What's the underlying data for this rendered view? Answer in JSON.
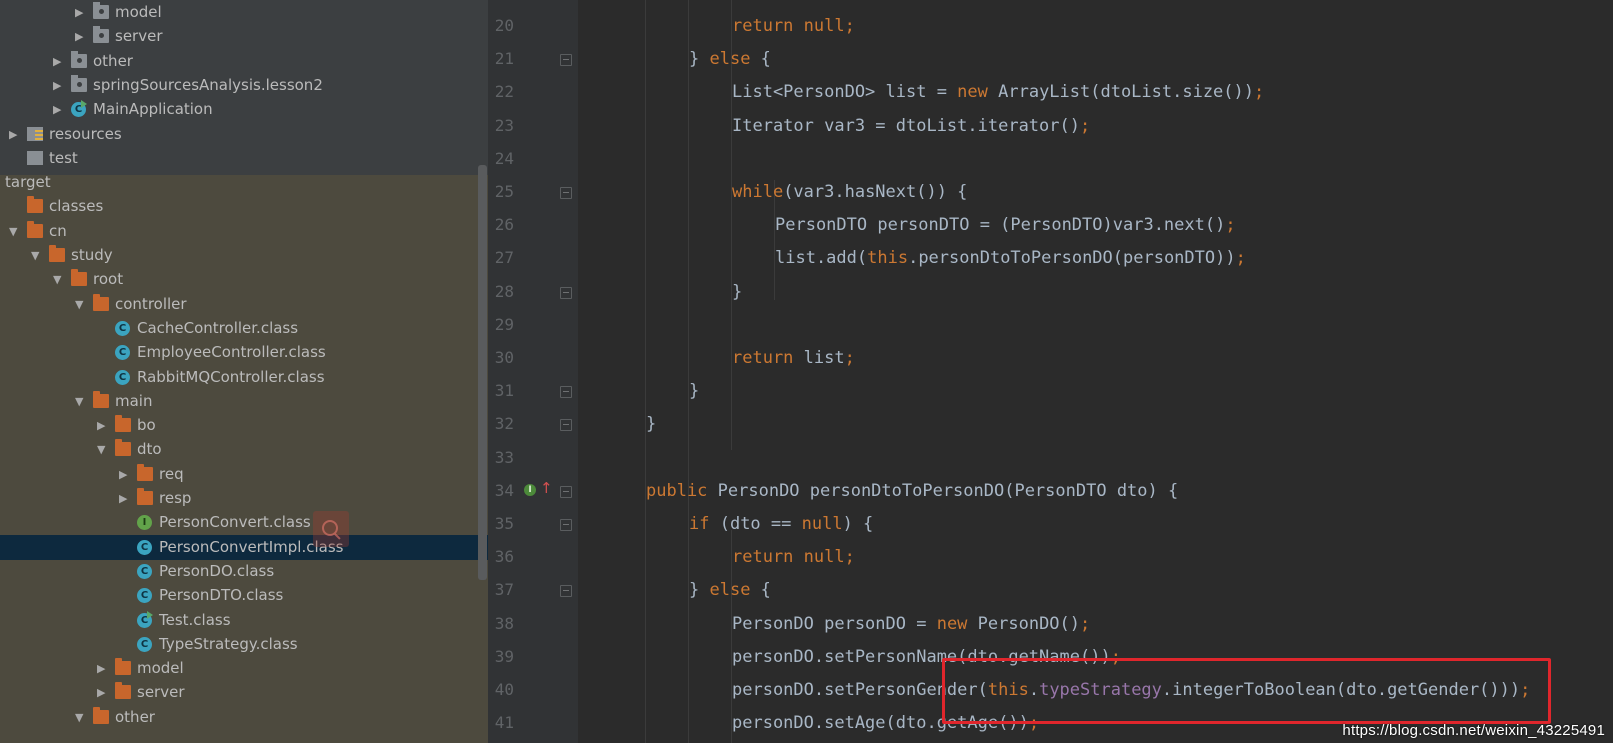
{
  "project_tree": {
    "items": [
      {
        "label": "model",
        "icon": "package-icon",
        "arrow": "collapsed",
        "depth": 4
      },
      {
        "label": "server",
        "icon": "package-icon",
        "arrow": "collapsed",
        "depth": 4
      },
      {
        "label": "other",
        "icon": "package-icon",
        "arrow": "collapsed",
        "depth": 3
      },
      {
        "label": "springSourcesAnalysis.lesson2",
        "icon": "package-icon",
        "arrow": "collapsed",
        "depth": 3
      },
      {
        "label": "MainApplication",
        "icon": "spring-app-class-icon",
        "arrow": "collapsed",
        "depth": 3
      },
      {
        "label": "resources",
        "icon": "resources-folder-icon",
        "arrow": "collapsed",
        "depth": 1
      },
      {
        "label": "test",
        "icon": "test-folder-icon",
        "arrow": "none",
        "depth": 1
      },
      {
        "label": "target",
        "icon": "none",
        "arrow": "none",
        "depth": 0
      },
      {
        "label": "classes",
        "icon": "folder-icon",
        "arrow": "none",
        "depth": 1
      },
      {
        "label": "cn",
        "icon": "folder-icon",
        "arrow": "expanded",
        "depth": 1
      },
      {
        "label": "study",
        "icon": "folder-icon",
        "arrow": "expanded",
        "depth": 2
      },
      {
        "label": "root",
        "icon": "folder-icon",
        "arrow": "expanded",
        "depth": 3
      },
      {
        "label": "controller",
        "icon": "folder-icon",
        "arrow": "expanded",
        "depth": 4
      },
      {
        "label": "CacheController.class",
        "icon": "class-icon",
        "arrow": "none",
        "depth": 5
      },
      {
        "label": "EmployeeController.class",
        "icon": "class-icon",
        "arrow": "none",
        "depth": 5
      },
      {
        "label": "RabbitMQController.class",
        "icon": "class-icon",
        "arrow": "none",
        "depth": 5
      },
      {
        "label": "main",
        "icon": "folder-icon",
        "arrow": "expanded",
        "depth": 4
      },
      {
        "label": "bo",
        "icon": "folder-icon",
        "arrow": "collapsed",
        "depth": 5
      },
      {
        "label": "dto",
        "icon": "folder-icon",
        "arrow": "expanded",
        "depth": 5
      },
      {
        "label": "req",
        "icon": "folder-icon",
        "arrow": "collapsed",
        "depth": 6
      },
      {
        "label": "resp",
        "icon": "folder-icon",
        "arrow": "collapsed",
        "depth": 6
      },
      {
        "label": "PersonConvert.class",
        "icon": "interface-icon",
        "arrow": "none",
        "depth": 6
      },
      {
        "label": "PersonConvertImpl.class",
        "icon": "class-icon",
        "arrow": "none",
        "depth": 6,
        "selected": true
      },
      {
        "label": "PersonDO.class",
        "icon": "class-icon",
        "arrow": "none",
        "depth": 6
      },
      {
        "label": "PersonDTO.class",
        "icon": "class-icon",
        "arrow": "none",
        "depth": 6
      },
      {
        "label": "Test.class",
        "icon": "runnable-class-icon",
        "arrow": "none",
        "depth": 6
      },
      {
        "label": "TypeStrategy.class",
        "icon": "class-icon",
        "arrow": "none",
        "depth": 6
      },
      {
        "label": "model",
        "icon": "folder-icon",
        "arrow": "collapsed",
        "depth": 5
      },
      {
        "label": "server",
        "icon": "folder-icon",
        "arrow": "collapsed",
        "depth": 5
      },
      {
        "label": "other",
        "icon": "folder-icon",
        "arrow": "expanded",
        "depth": 4
      }
    ]
  },
  "editor": {
    "lines": [
      {
        "num": "20",
        "indent": 3,
        "fold": false,
        "tokens": [
          [
            "kw",
            "return "
          ],
          [
            "kw",
            "null"
          ],
          [
            "sm",
            ";"
          ]
        ]
      },
      {
        "num": "21",
        "indent": 2,
        "fold": true,
        "tokens": [
          [
            "p",
            "} "
          ],
          [
            "kw",
            "else"
          ],
          [
            "p",
            " {"
          ]
        ]
      },
      {
        "num": "22",
        "indent": 3,
        "fold": false,
        "tokens": [
          [
            "p",
            "List<PersonDO> list = "
          ],
          [
            "kw",
            "new "
          ],
          [
            "p",
            "ArrayList(dtoList.size())"
          ],
          [
            "sm",
            ";"
          ]
        ]
      },
      {
        "num": "23",
        "indent": 3,
        "fold": false,
        "tokens": [
          [
            "p",
            "Iterator var3 = dtoList.iterator()"
          ],
          [
            "sm",
            ";"
          ]
        ]
      },
      {
        "num": "24",
        "indent": 0,
        "fold": false,
        "tokens": []
      },
      {
        "num": "25",
        "indent": 3,
        "fold": true,
        "tokens": [
          [
            "kw",
            "while"
          ],
          [
            "p",
            "(var3.hasNext()) {"
          ]
        ]
      },
      {
        "num": "26",
        "indent": 4,
        "fold": false,
        "tokens": [
          [
            "p",
            "PersonDTO personDTO = (PersonDTO)var3.next()"
          ],
          [
            "sm",
            ";"
          ]
        ]
      },
      {
        "num": "27",
        "indent": 4,
        "fold": false,
        "tokens": [
          [
            "p",
            "list.add("
          ],
          [
            "kw",
            "this"
          ],
          [
            "p",
            ".personDtoToPersonDO(personDTO))"
          ],
          [
            "sm",
            ";"
          ]
        ]
      },
      {
        "num": "28",
        "indent": 3,
        "fold": true,
        "tokens": [
          [
            "p",
            "}"
          ]
        ]
      },
      {
        "num": "29",
        "indent": 0,
        "fold": false,
        "tokens": []
      },
      {
        "num": "30",
        "indent": 3,
        "fold": false,
        "tokens": [
          [
            "kw",
            "return "
          ],
          [
            "p",
            "list"
          ],
          [
            "sm",
            ";"
          ]
        ]
      },
      {
        "num": "31",
        "indent": 2,
        "fold": true,
        "tokens": [
          [
            "p",
            "}"
          ]
        ]
      },
      {
        "num": "32",
        "indent": 1,
        "fold": true,
        "tokens": [
          [
            "p",
            "}"
          ]
        ]
      },
      {
        "num": "33",
        "indent": 0,
        "fold": false,
        "tokens": []
      },
      {
        "num": "34",
        "indent": 1,
        "fold": true,
        "override": true,
        "tokens": [
          [
            "kw",
            "public "
          ],
          [
            "p",
            "PersonDO personDtoToPersonDO(PersonDTO dto) {"
          ]
        ]
      },
      {
        "num": "35",
        "indent": 2,
        "fold": true,
        "tokens": [
          [
            "kw",
            "if "
          ],
          [
            "p",
            "(dto == "
          ],
          [
            "kw",
            "null"
          ],
          [
            "p",
            ") {"
          ]
        ]
      },
      {
        "num": "36",
        "indent": 3,
        "fold": false,
        "tokens": [
          [
            "kw",
            "return "
          ],
          [
            "kw",
            "null"
          ],
          [
            "sm",
            ";"
          ]
        ]
      },
      {
        "num": "37",
        "indent": 2,
        "fold": true,
        "tokens": [
          [
            "p",
            "} "
          ],
          [
            "kw",
            "else"
          ],
          [
            "p",
            " {"
          ]
        ]
      },
      {
        "num": "38",
        "indent": 3,
        "fold": false,
        "tokens": [
          [
            "p",
            "PersonDO personDO = "
          ],
          [
            "kw",
            "new "
          ],
          [
            "p",
            "PersonDO()"
          ],
          [
            "sm",
            ";"
          ]
        ]
      },
      {
        "num": "39",
        "indent": 3,
        "fold": false,
        "tokens": [
          [
            "p",
            "personDO.setPersonName(dto.getName())"
          ],
          [
            "sm",
            ";"
          ]
        ]
      },
      {
        "num": "40",
        "indent": 3,
        "fold": false,
        "tokens": [
          [
            "p",
            "personDO.setPersonGender("
          ],
          [
            "kw",
            "this"
          ],
          [
            "p",
            "."
          ],
          [
            "fld",
            "typeStrategy"
          ],
          [
            "p",
            ".integerToBoolean(dto.getGender()))"
          ],
          [
            "sm",
            ";"
          ]
        ]
      },
      {
        "num": "41",
        "indent": 3,
        "fold": false,
        "tokens": [
          [
            "p",
            "personDO.setAge(dto.getAge())"
          ],
          [
            "sm",
            ";"
          ]
        ]
      }
    ]
  },
  "watermark": "https://blog.csdn.net/weixin_43225491",
  "colors": {
    "keyword": "#cc7832",
    "plain": "#a9b7c6",
    "field": "#9876aa",
    "highlight_box": "#e0262c",
    "selection": "#0d293e"
  }
}
